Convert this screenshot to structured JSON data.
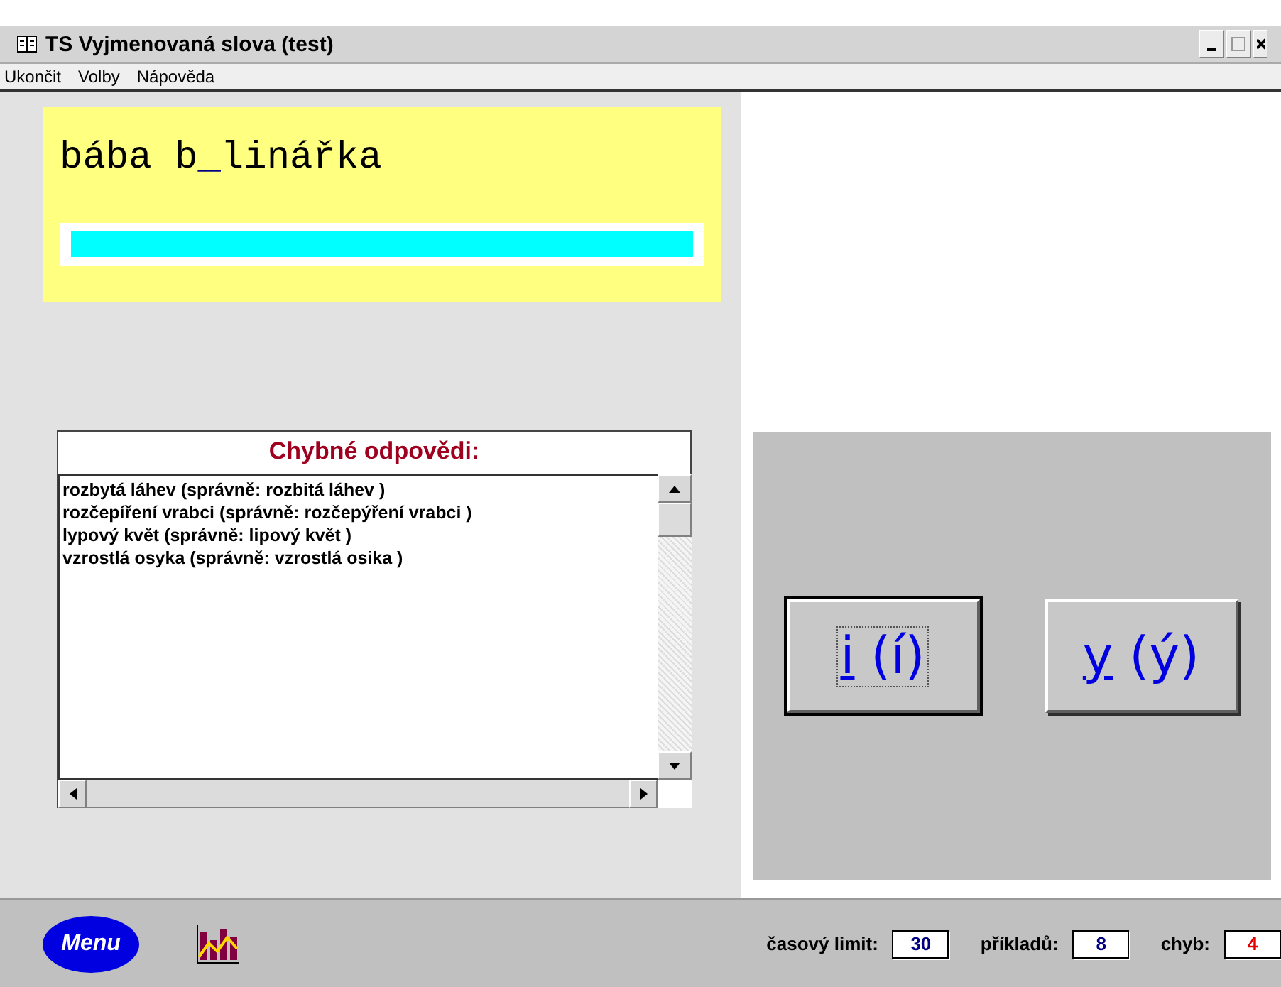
{
  "window": {
    "title": "TS Vyjmenovaná slova (test)"
  },
  "menu": [
    "Ukončit",
    "Volby",
    "Nápověda"
  ],
  "task": {
    "before": "bába b",
    "blank": "_",
    "after": "linářka"
  },
  "errors": {
    "title": "Chybné odpovědi:",
    "items": [
      "rozbytá láhev  (správně: rozbitá láhev )",
      "rozčepíření vrabci  (správně: rozčepýření vrabci )",
      "lypový květ  (správně: lipový květ )",
      "vzrostlá osyka  (správně: vzrostlá osika )"
    ]
  },
  "answers": [
    {
      "key": "i",
      "rest": " (í)",
      "selected": true
    },
    {
      "key": "y",
      "rest": " (ý)",
      "selected": false
    }
  ],
  "status": {
    "menu": "Menu",
    "fields": [
      {
        "label": "časový limit:",
        "value": "30",
        "color": "#000080"
      },
      {
        "label": "příkladů:",
        "value": "8",
        "color": "#000080"
      },
      {
        "label": "chyb:",
        "value": "4",
        "color": "#e00000"
      }
    ]
  }
}
